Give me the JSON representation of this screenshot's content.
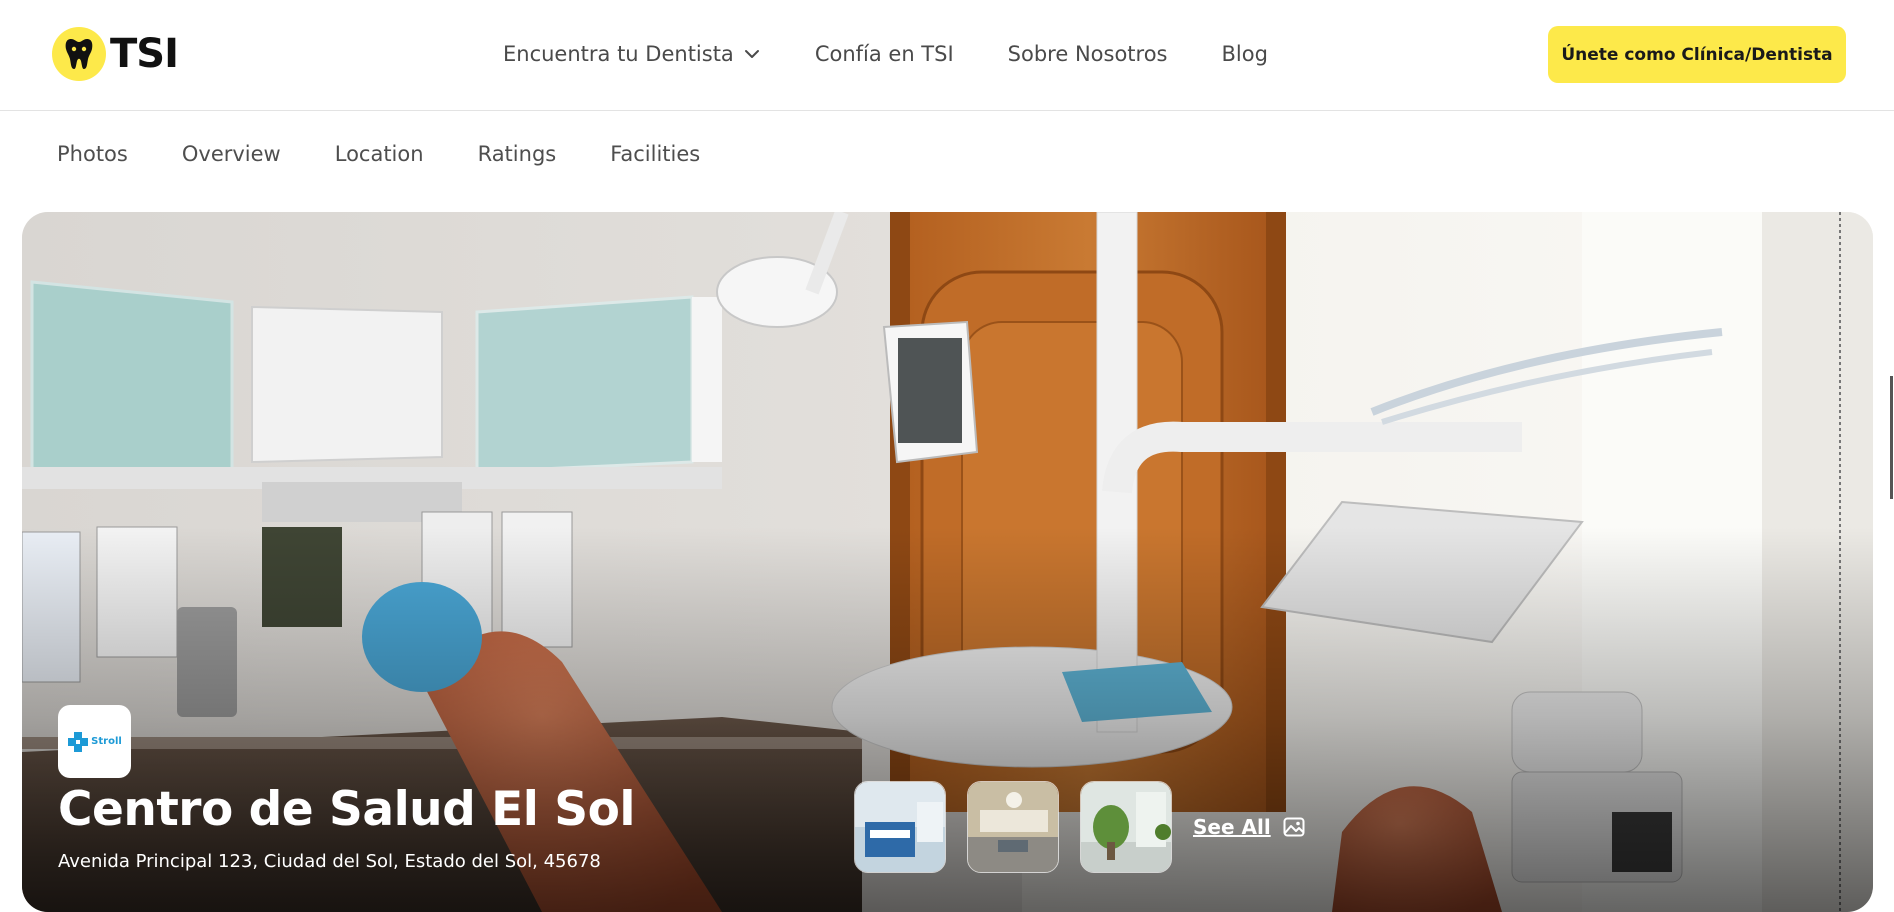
{
  "header": {
    "logo_text": "TSI",
    "nav": [
      {
        "label": "Encuentra tu Dentista",
        "has_dropdown": true
      },
      {
        "label": "Confía en TSI",
        "has_dropdown": false
      },
      {
        "label": "Sobre Nosotros",
        "has_dropdown": false
      },
      {
        "label": "Blog",
        "has_dropdown": false
      }
    ],
    "cta_label": "Únete como Clínica/Dentista"
  },
  "subnav": {
    "items": [
      "Photos",
      "Overview",
      "Location",
      "Ratings",
      "Facilities"
    ]
  },
  "hero": {
    "clinic_logo_text": "Stroll",
    "clinic_name": "Centro de Salud El Sol",
    "address": "Avenida Principal 123, Ciudad del Sol, Estado del Sol, 45678",
    "thumbnails": [
      "reception-photo",
      "operating-room-photo",
      "lobby-plant-photo"
    ],
    "see_all_label": "See All"
  },
  "colors": {
    "brand_yellow": "#fde94a",
    "nav_text": "#4a4a4a",
    "hero_text": "#ffffff"
  },
  "icons": {
    "logo": "tooth-icon",
    "dropdown": "chevron-down-icon",
    "gallery": "image-icon"
  }
}
